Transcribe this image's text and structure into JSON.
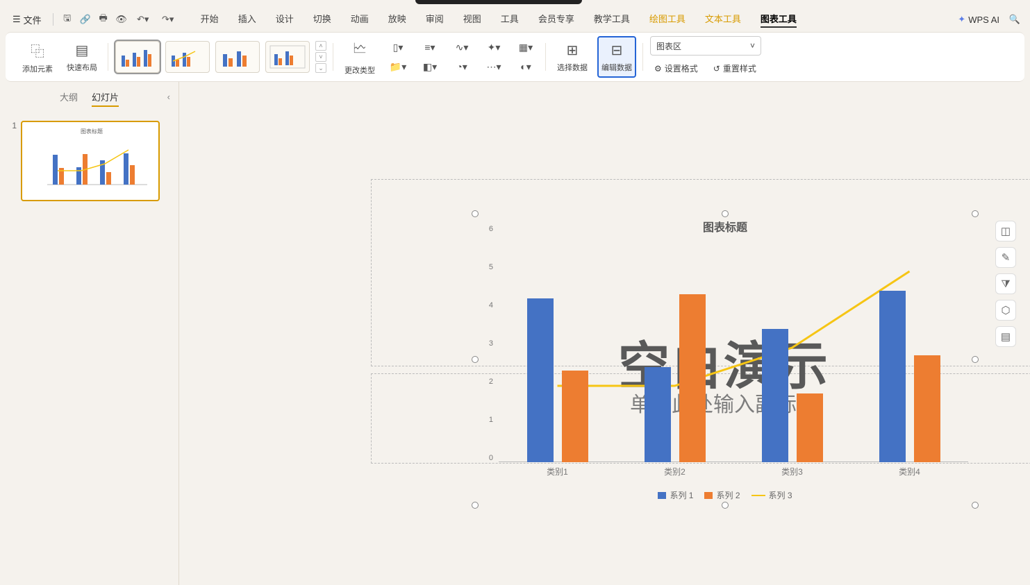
{
  "menubar": {
    "file": "文件",
    "tabs": [
      "开始",
      "插入",
      "设计",
      "切换",
      "动画",
      "放映",
      "审阅",
      "视图",
      "工具",
      "会员专享",
      "教学工具"
    ],
    "context_tabs": [
      "绘图工具",
      "文本工具",
      "图表工具"
    ],
    "active_context": "图表工具",
    "wpsai": "WPS AI"
  },
  "ribbon": {
    "add_element": "添加元素",
    "quick_layout": "快速布局",
    "change_type": "更改类型",
    "select_data": "选择数据",
    "edit_data": "编辑数据",
    "area_select": "图表区",
    "set_format": "设置格式",
    "reset_style": "重置样式"
  },
  "sidepanel": {
    "outline": "大纲",
    "slides": "幻灯片",
    "thumb1_num": "1"
  },
  "slide": {
    "watermark_title": "空白演示",
    "watermark_sub": "单击此处输入副标题"
  },
  "chart_data": {
    "type": "bar",
    "title": "图表标题",
    "categories": [
      "类别1",
      "类别2",
      "类别3",
      "类别4"
    ],
    "series": [
      {
        "name": "系列 1",
        "color": "#4472c4",
        "values": [
          4.3,
          2.5,
          3.5,
          4.5
        ]
      },
      {
        "name": "系列 2",
        "color": "#ed7d31",
        "values": [
          2.4,
          4.4,
          1.8,
          2.8
        ]
      },
      {
        "name": "系列 3",
        "color": "#f6c514",
        "type": "line",
        "values": [
          2.0,
          2.0,
          3.0,
          5.0
        ]
      }
    ],
    "ylim": [
      0,
      6
    ],
    "yticks": [
      0,
      1,
      2,
      3,
      4,
      5,
      6
    ],
    "xlabel": "",
    "ylabel": ""
  }
}
